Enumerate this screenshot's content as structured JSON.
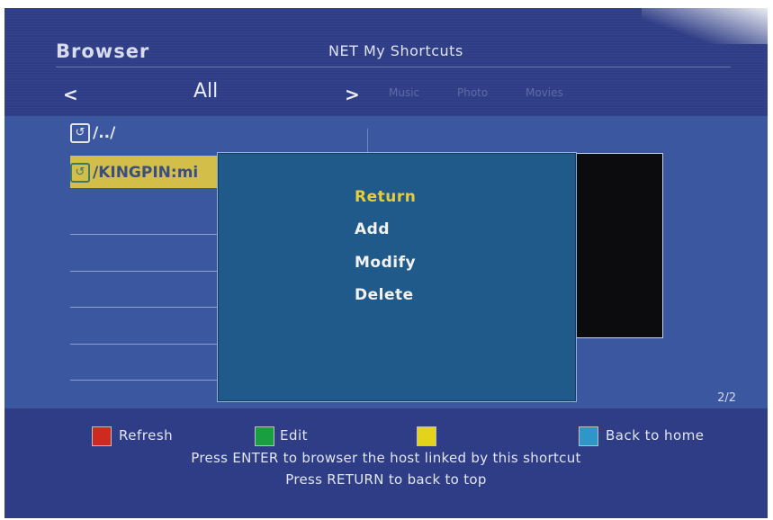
{
  "header": {
    "brand": "Browser",
    "title": "NET My Shortcuts"
  },
  "nav": {
    "prev_arrow": "<",
    "current": "All",
    "next_arrow": ">",
    "others": [
      "Music",
      "Photo",
      "Movies"
    ]
  },
  "list": {
    "items": [
      {
        "label": "/../",
        "selected": false
      },
      {
        "label": "/KINGPIN:mi",
        "selected": true
      }
    ],
    "page": "2/2"
  },
  "popup_menu": {
    "items": [
      "Return",
      "Add",
      "Modify",
      "Delete"
    ],
    "active_index": 0
  },
  "footer": {
    "keys": [
      {
        "color": "red",
        "hex": "#d02a20",
        "label": "Refresh"
      },
      {
        "color": "green",
        "hex": "#18a040",
        "label": "Edit"
      },
      {
        "color": "yellow",
        "hex": "#e4d21c",
        "label": ""
      },
      {
        "color": "blue",
        "hex": "#2f96c8",
        "label": "Back to home"
      }
    ],
    "hint_line1": "Press ENTER to browser the host linked by this shortcut",
    "hint_line2": "Press RETURN to back to top"
  },
  "colors": {
    "background": "#2e3d86",
    "content_panel": "#3a57a0",
    "popup": "#1f5a8a",
    "selection": "#d3be4a",
    "active_menu_text": "#e6cd3b"
  }
}
